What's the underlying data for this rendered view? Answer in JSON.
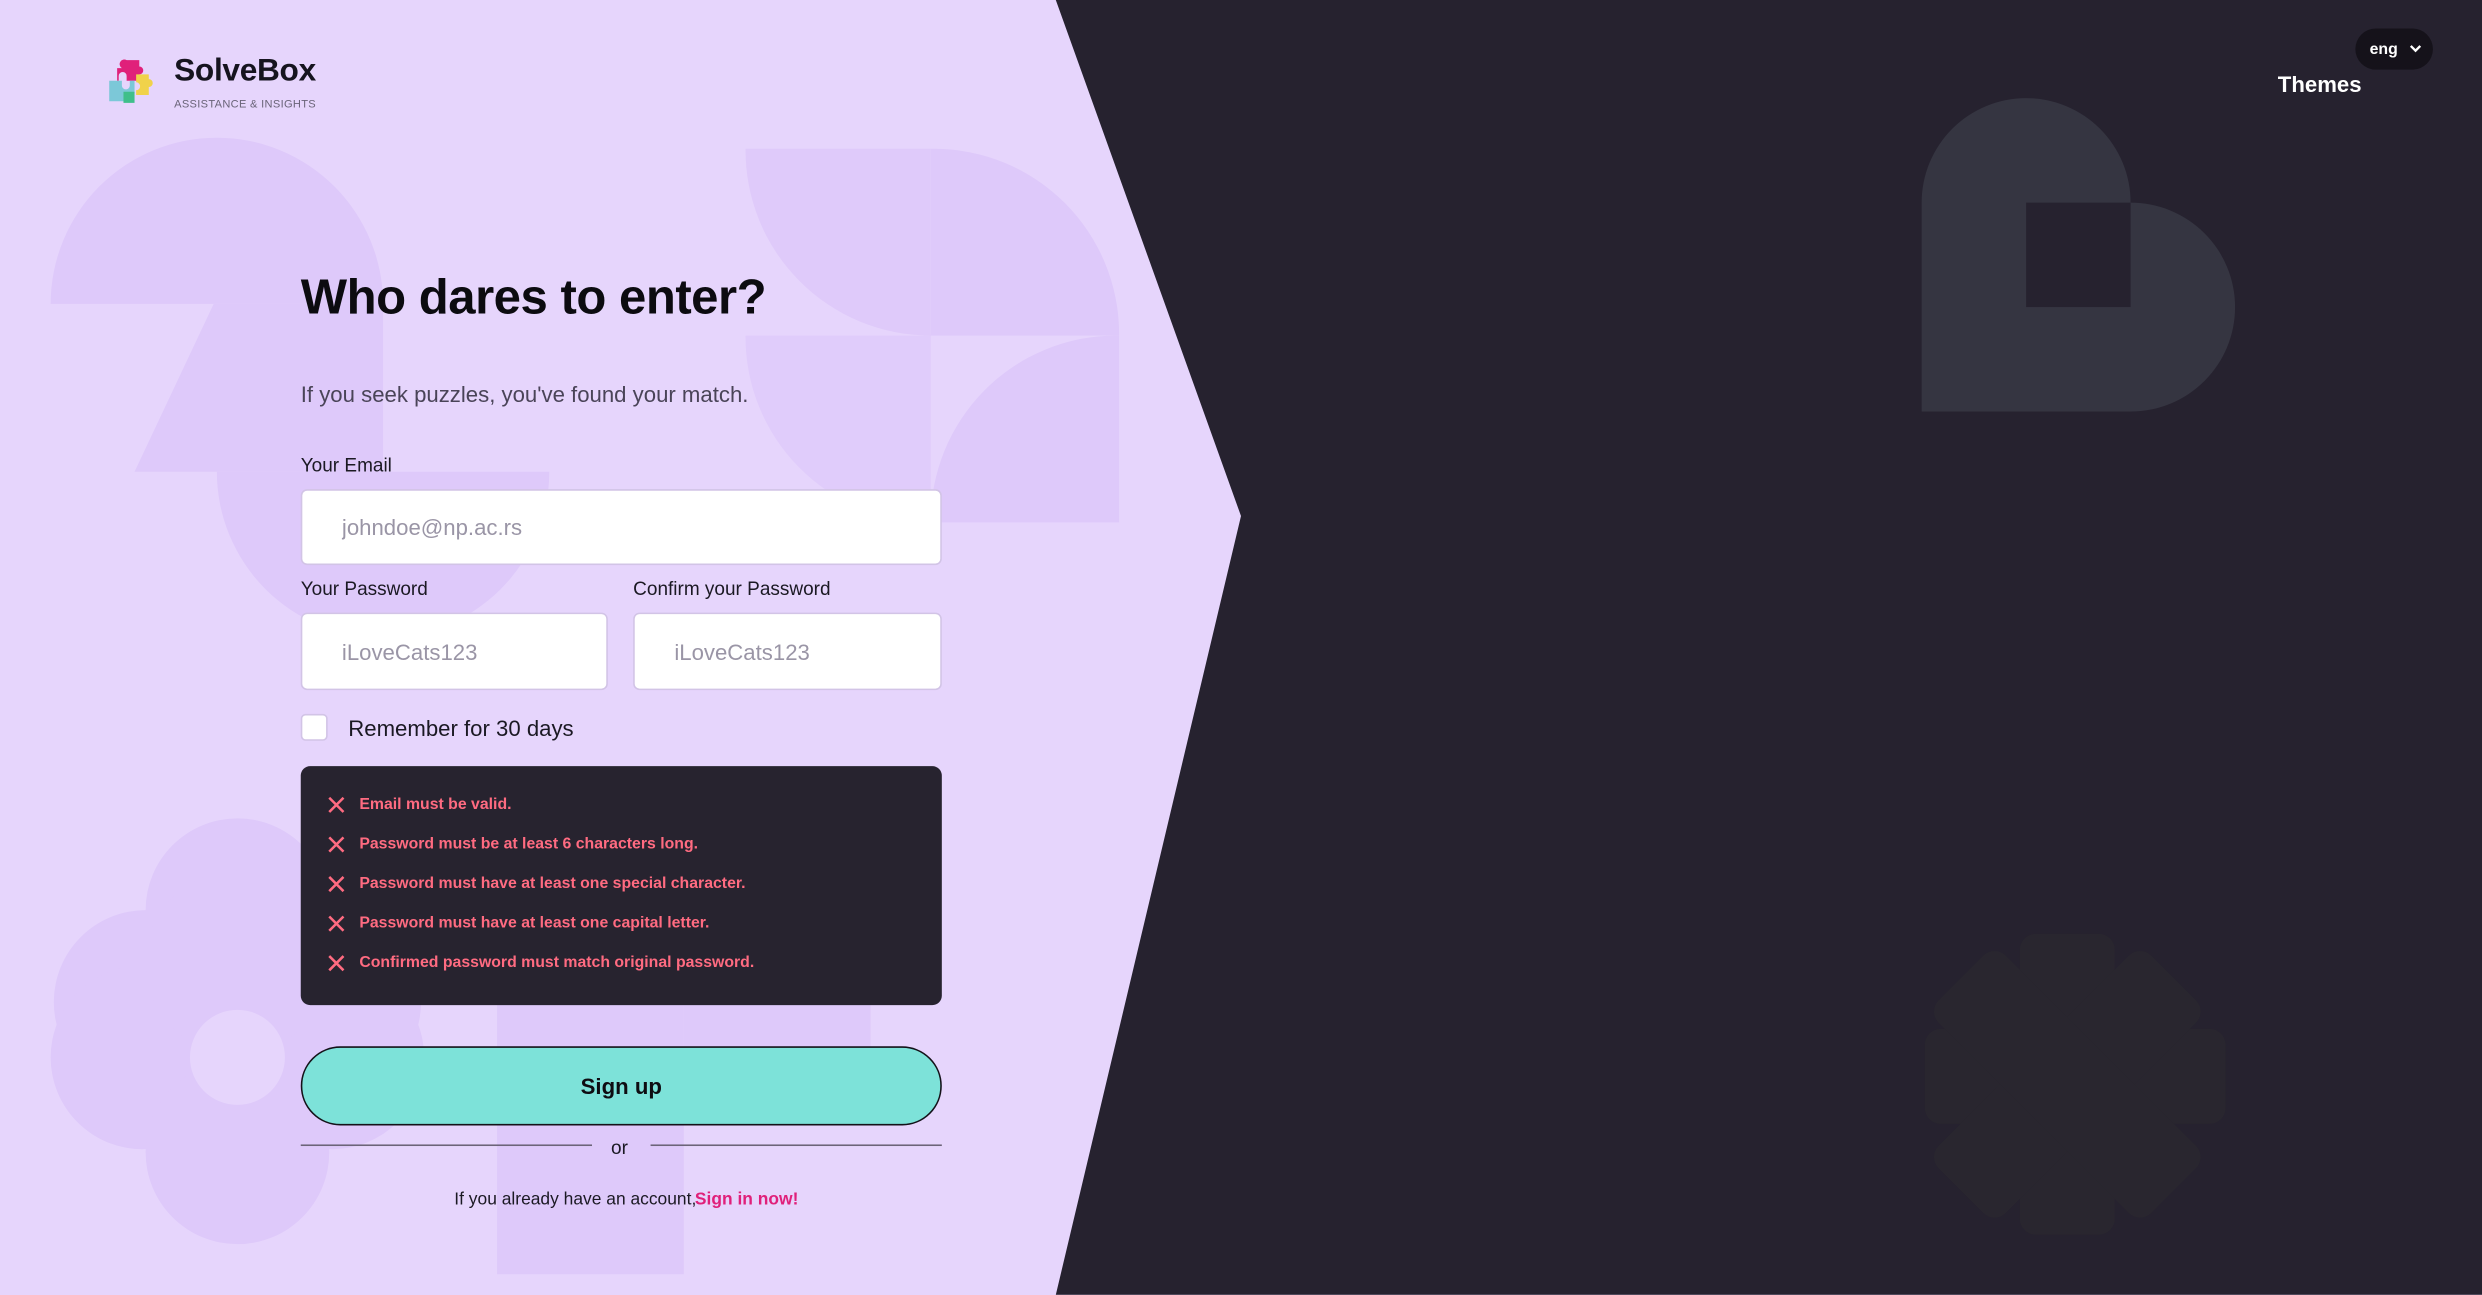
{
  "brand": {
    "name": "SolveBox",
    "tagline": "ASSISTANCE & INSIGHTS"
  },
  "header": {
    "language": "eng",
    "themes_label": "Themes"
  },
  "form": {
    "title": "Who dares to enter?",
    "subtitle": "If you seek puzzles, you've found your match.",
    "email": {
      "label": "Your Email",
      "placeholder": "johndoe@np.ac.rs",
      "value": ""
    },
    "password": {
      "label": "Your Password",
      "placeholder": "iLoveCats123",
      "value": ""
    },
    "confirm_password": {
      "label": "Confirm your Password",
      "placeholder": "iLoveCats123",
      "value": ""
    },
    "remember": {
      "label": "Remember for 30 days",
      "checked": false
    },
    "errors": [
      "Email must be valid.",
      "Password must be at least 6 characters long.",
      "Password must have at least one special character.",
      "Password must have at least one capital letter.",
      "Confirmed password must match original password."
    ],
    "submit_label": "Sign up",
    "divider_label": "or",
    "signin_prompt": "If you already have an account,",
    "signin_link": "Sign in now!"
  },
  "colors": {
    "left_panel": "#e6d5fc",
    "right_panel": "#26222f",
    "accent_button": "#7de2d9",
    "error_text": "#ff6b81",
    "link": "#e0207a"
  }
}
